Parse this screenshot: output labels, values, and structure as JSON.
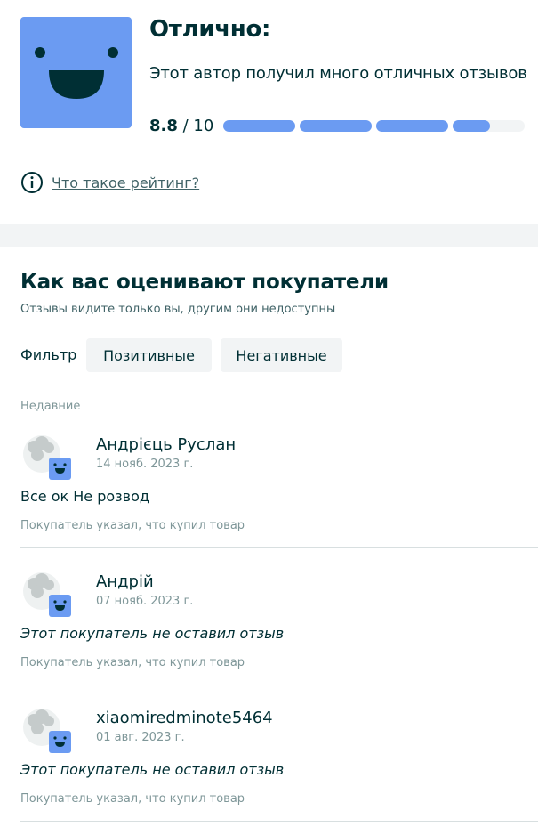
{
  "rating": {
    "verdict": "Отлично:",
    "description": "Этот автор получил много отличных отзывов",
    "score_value": "8.8",
    "score_max": "/ 10",
    "score_fraction": 0.88,
    "info_link": "Что такое рейтинг?",
    "face_icon": "smiley-face-icon",
    "accent_color": "#6b9bf2"
  },
  "section": {
    "title": "Как вас оценивают покупатели",
    "subtitle": "Отзывы видите только вы, другим они недоступны"
  },
  "filter": {
    "label": "Фильтр",
    "positive": "Позитивные",
    "negative": "Негативные"
  },
  "recent_label": "Недавние",
  "reviews": [
    {
      "name": "Андрієць Руслан",
      "date": "14 нояб. 2023 г.",
      "text": "Все ок Не розвод",
      "note": "Покупатель указал, что купил товар"
    },
    {
      "name": "Андрій",
      "date": "07 нояб. 2023 г.",
      "text": "Этот покупатель не оставил отзыв",
      "note": "Покупатель указал, что купил товар"
    },
    {
      "name": "xiaomiredminote5464",
      "date": "01 авг. 2023 г.",
      "text": "Этот покупатель не оставил отзыв",
      "note": "Покупатель указал, что купил товар"
    }
  ]
}
